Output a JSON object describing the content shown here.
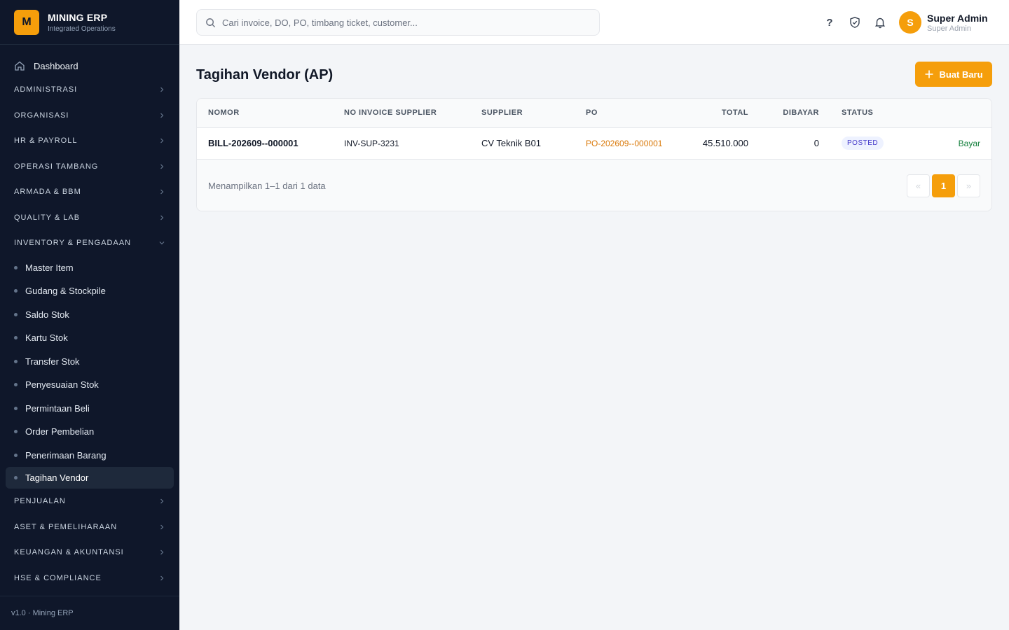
{
  "brand": {
    "logo_letter": "M",
    "name": "MINING ERP",
    "subtitle": "Integrated Operations"
  },
  "sidebar": {
    "dashboard": "Dashboard",
    "groups_top": [
      {
        "label": "ADMINISTRASI"
      },
      {
        "label": "ORGANISASI"
      },
      {
        "label": "HR & PAYROLL"
      },
      {
        "label": "OPERASI TAMBANG"
      },
      {
        "label": "ARMADA & BBM"
      },
      {
        "label": "QUALITY & LAB"
      }
    ],
    "expanded_group": "INVENTORY & PENGADAAN",
    "sub_items": [
      {
        "label": "Master Item"
      },
      {
        "label": "Gudang & Stockpile"
      },
      {
        "label": "Saldo Stok"
      },
      {
        "label": "Kartu Stok"
      },
      {
        "label": "Transfer Stok"
      },
      {
        "label": "Penyesuaian Stok"
      },
      {
        "label": "Permintaan Beli"
      },
      {
        "label": "Order Pembelian"
      },
      {
        "label": "Penerimaan Barang"
      },
      {
        "label": "Tagihan Vendor"
      }
    ],
    "active_item": "Tagihan Vendor",
    "groups_bottom": [
      {
        "label": "PENJUALAN"
      },
      {
        "label": "ASET & PEMELIHARAAN"
      },
      {
        "label": "KEUANGAN & AKUNTANSI"
      },
      {
        "label": "HSE & COMPLIANCE"
      }
    ],
    "footer": "v1.0 · Mining ERP"
  },
  "topbar": {
    "search_placeholder": "Cari invoice, DO, PO, timbang ticket, customer...",
    "help_label": "?",
    "user": {
      "initial": "S",
      "name": "Super Admin",
      "role": "Super Admin"
    }
  },
  "page": {
    "title": "Tagihan Vendor (AP)",
    "new_button": "Buat Baru"
  },
  "table": {
    "headers": {
      "nomor": "NOMOR",
      "invoice": "NO INVOICE SUPPLIER",
      "supplier": "SUPPLIER",
      "po": "PO",
      "total": "TOTAL",
      "dibayar": "DIBAYAR",
      "status": "STATUS"
    },
    "rows": [
      {
        "nomor": "BILL-202609--000001",
        "invoice": "INV-SUP-3231",
        "supplier": "CV Teknik B01",
        "po": "PO-202609--000001",
        "total": "45.510.000",
        "dibayar": "0",
        "status": "POSTED",
        "action": "Bayar"
      }
    ],
    "footer_text": "Menampilkan 1–1 dari 1 data",
    "pager": {
      "prev": "«",
      "current": "1",
      "next": "»"
    }
  },
  "colors": {
    "accent": "#f59e0b",
    "sidebar_bg": "#0f172a",
    "link_orange": "#d97706",
    "pay_green": "#15803d"
  }
}
